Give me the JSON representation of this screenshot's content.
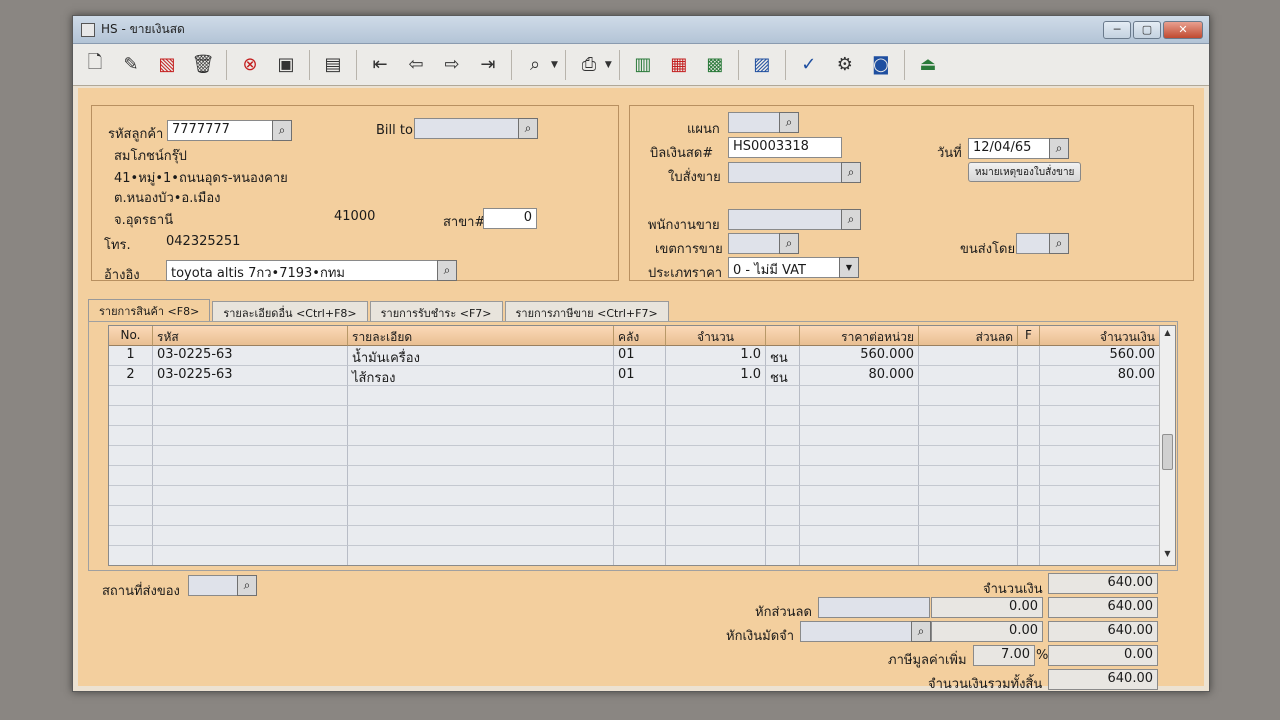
{
  "window": {
    "title": "HS - ขายเงินสด"
  },
  "toolbar": {
    "buttons": [
      "new-icon",
      "edit-icon",
      "delete-icon",
      "trash-icon",
      "cancel-icon",
      "save-icon",
      "search-records-icon",
      "first-icon",
      "prev-icon",
      "next-icon",
      "last-icon",
      "find-icon",
      "print-icon",
      "preview-icon",
      "export-icon",
      "report-icon",
      "calc-icon",
      "approve-icon",
      "tools-icon",
      "ok-icon",
      "exit-icon"
    ]
  },
  "customer": {
    "code_label": "รหัสลูกค้า",
    "code": "7777777",
    "billto_label": "Bill to",
    "name": "สมโภชน์กรุ๊ป",
    "addr1": "41•หมู่•1•ถนนอุดร-หนองคาย",
    "addr2": "ต.หนองบัว•อ.เมือง",
    "addr3": "จ.อุดรธานี",
    "postcode": "41000",
    "branch_label": "สาขา#",
    "branch": "0",
    "phone_label": "โทร.",
    "phone": "042325251",
    "ref_label": "อ้างอิง",
    "ref": "toyota altis 7กว•7193•กทม"
  },
  "doc": {
    "dept_label": "แผนก",
    "bill_label": "บิลเงินสด#",
    "bill": "HS0003318",
    "date_label": "วันที่",
    "date": "12/04/65",
    "order_label": "ใบสั่งขาย",
    "order_note_btn": "หมายเหตุของใบสั่งขาย",
    "salesman_label": "พนักงานขาย",
    "area_label": "เขตการขาย",
    "ship_label": "ขนส่งโดย",
    "price_type_label": "ประเภทราคา",
    "price_type": "0 - ไม่มี VAT"
  },
  "tabs": [
    "รายการสินค้า <F8>",
    "รายละเอียดอื่น <Ctrl+F8>",
    "รายการรับชำระ <F7>",
    "รายการภาษีขาย <Ctrl+F7>"
  ],
  "table": {
    "headers": [
      "No.",
      "รหัส",
      "รายละเอียด",
      "คลัง",
      "จำนวน",
      "",
      "ราคาต่อหน่วย",
      "ส่วนลด",
      "F",
      "จำนวนเงิน"
    ],
    "rows": [
      [
        "1",
        "03-0225-63",
        "น้ำมันเครื่อง",
        "01",
        "1.0",
        "ชน",
        "560.000",
        "",
        "",
        "560.00"
      ],
      [
        "2",
        "03-0225-63",
        "ไส้กรอง",
        "01",
        "1.0",
        "ชน",
        "80.000",
        "",
        "",
        "80.00"
      ]
    ]
  },
  "footer": {
    "deliver_label": "สถานที่ส่งของ",
    "amount_label": "จำนวนเงิน",
    "amount": "640.00",
    "discount_label": "หักส่วนลด",
    "discount": "0.00",
    "after_discount": "640.00",
    "deposit_label": "หักเงินมัดจำ",
    "deposit": "0.00",
    "after_deposit": "640.00",
    "vat_label": "ภาษีมูลค่าเพิ่ม",
    "vat_rate": "7.00",
    "vat_pct": "%",
    "vat_amount": "0.00",
    "total_label": "จำนวนเงินรวมทั้งสิ้น",
    "total": "640.00"
  }
}
